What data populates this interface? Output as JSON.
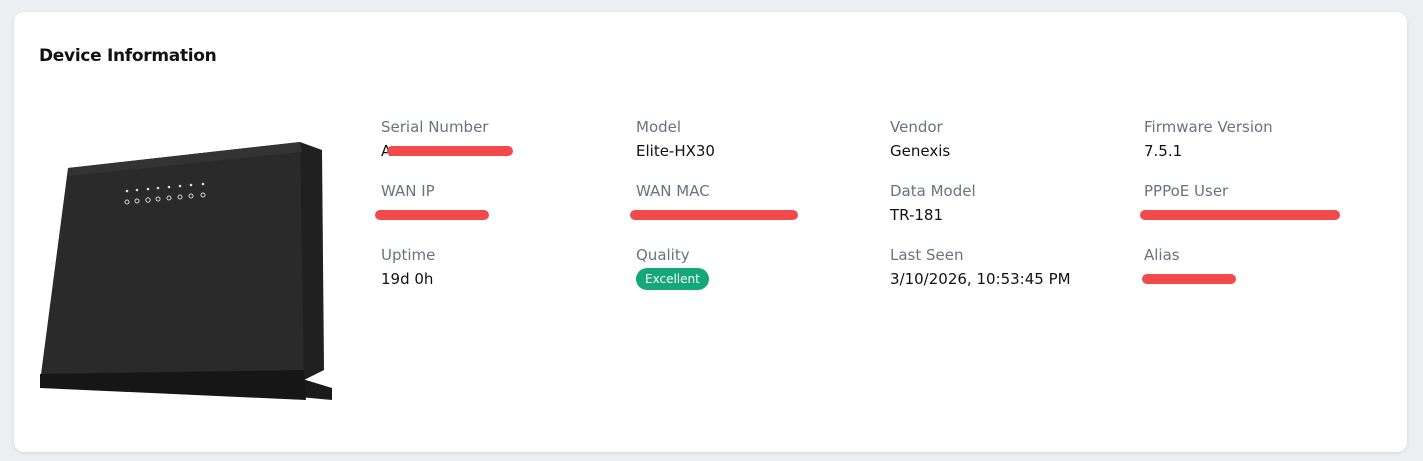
{
  "card": {
    "title": "Device Information",
    "image_alt": "Genexis router"
  },
  "fields": {
    "serial_number": {
      "label": "Serial Number",
      "value": "A"
    },
    "model": {
      "label": "Model",
      "value": "Elite-HX30"
    },
    "vendor": {
      "label": "Vendor",
      "value": "Genexis"
    },
    "firmware_version": {
      "label": "Firmware Version",
      "value": "7.5.1"
    },
    "wan_ip": {
      "label": "WAN IP",
      "value": ""
    },
    "wan_mac": {
      "label": "WAN MAC",
      "value": ""
    },
    "data_model": {
      "label": "Data Model",
      "value": "TR-181"
    },
    "pppoe_user": {
      "label": "PPPoE User",
      "value": ""
    },
    "uptime": {
      "label": "Uptime",
      "value": "19d 0h"
    },
    "quality": {
      "label": "Quality",
      "value": "Excellent"
    },
    "last_seen": {
      "label": "Last Seen",
      "value": "3/10/2026, 10:53:45 PM"
    },
    "alias": {
      "label": "Alias",
      "value": ""
    }
  },
  "colors": {
    "quality_badge": "#14a878",
    "redaction": "#f24a4a",
    "label_text": "#6b7280"
  }
}
